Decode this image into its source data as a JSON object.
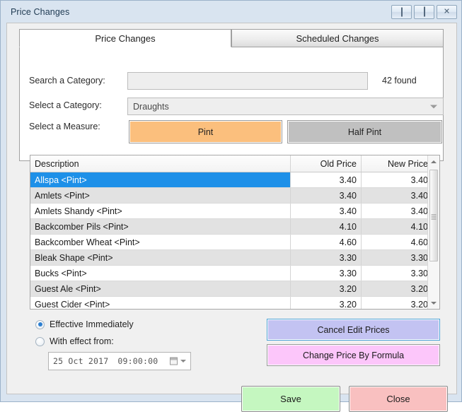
{
  "window": {
    "title": "Price Changes",
    "buttons": {
      "minimize": "minimize-icon",
      "maximize": "maximize-icon",
      "close": "close-icon",
      "close_glyph": "✕"
    }
  },
  "tabs": [
    {
      "label": "Price Changes",
      "active": true
    },
    {
      "label": "Scheduled Changes",
      "active": false
    }
  ],
  "form": {
    "search_label": "Search a Category:",
    "search_value": "",
    "search_placeholder": "",
    "found_text": "42 found",
    "category_label": "Select a Category:",
    "category_value": "Draughts",
    "measure_label": "Select a Measure:",
    "measures": [
      {
        "label": "Pint",
        "selected": true
      },
      {
        "label": "Half Pint",
        "selected": false
      }
    ]
  },
  "grid": {
    "columns": [
      "Description",
      "Old Price",
      "New Price"
    ],
    "rows": [
      {
        "description": "Allspa <Pint>",
        "old_price": "3.40",
        "new_price": "3.40",
        "selected": true,
        "alt": false
      },
      {
        "description": "Amlets <Pint>",
        "old_price": "3.40",
        "new_price": "3.40",
        "selected": false,
        "alt": true
      },
      {
        "description": "Amlets Shandy <Pint>",
        "old_price": "3.40",
        "new_price": "3.40",
        "selected": false,
        "alt": false
      },
      {
        "description": "Backcomber Pils <Pint>",
        "old_price": "4.10",
        "new_price": "4.10",
        "selected": false,
        "alt": true
      },
      {
        "description": "Backcomber Wheat <Pint>",
        "old_price": "4.60",
        "new_price": "4.60",
        "selected": false,
        "alt": false
      },
      {
        "description": "Bleak Shape <Pint>",
        "old_price": "3.30",
        "new_price": "3.30",
        "selected": false,
        "alt": true
      },
      {
        "description": "Bucks <Pint>",
        "old_price": "3.30",
        "new_price": "3.30",
        "selected": false,
        "alt": false
      },
      {
        "description": "Guest Ale <Pint>",
        "old_price": "3.20",
        "new_price": "3.20",
        "selected": false,
        "alt": true
      },
      {
        "description": "Guest Cider <Pint>",
        "old_price": "3.20",
        "new_price": "3.20",
        "selected": false,
        "alt": false
      }
    ]
  },
  "effective": {
    "immediately_label": "Effective Immediately",
    "immediately_selected": true,
    "with_effect_label": "With effect from:",
    "with_effect_selected": false,
    "date_value": "25 Oct 2017",
    "time_value": "09:00:00"
  },
  "actions": {
    "cancel_edit": "Cancel Edit Prices",
    "change_formula": "Change Price By Formula",
    "save": "Save",
    "close": "Close"
  },
  "colors": {
    "selection_blue": "#1e90e8",
    "measure_selected": "#fbbf7d",
    "measure_unselected": "#c0c0c0",
    "cancel_button": "#c3c3f2",
    "formula_button": "#fcc6fa",
    "save_button": "#c5f7c0",
    "close_button": "#f9c0c0",
    "window_frame": "#d9e4f0"
  }
}
